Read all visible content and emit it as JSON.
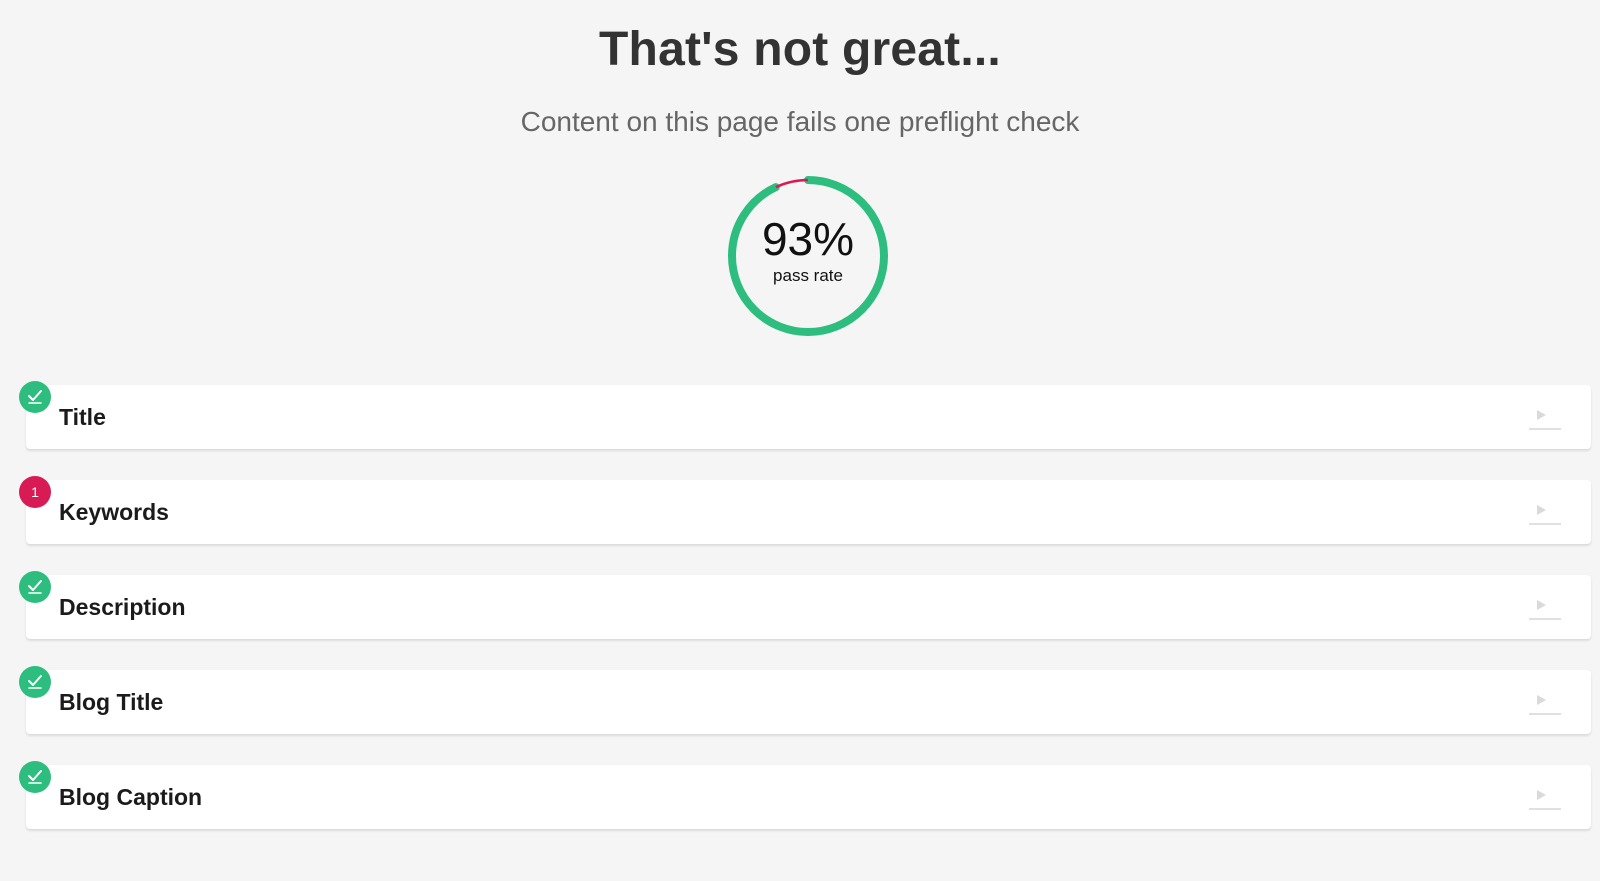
{
  "heading": "That's not great...",
  "subheading": "Content on this page fails one preflight check",
  "gauge": {
    "percent": 93,
    "value_text": "93%",
    "label": "pass rate",
    "pass_color": "#2dbd7e",
    "fail_color": "#d81b55"
  },
  "checks": [
    {
      "label": "Title",
      "status": "pass",
      "badge_icon": "check-icon",
      "count": ""
    },
    {
      "label": "Keywords",
      "status": "fail",
      "badge_icon": "",
      "count": "1"
    },
    {
      "label": "Description",
      "status": "pass",
      "badge_icon": "check-icon",
      "count": ""
    },
    {
      "label": "Blog Title",
      "status": "pass",
      "badge_icon": "check-icon",
      "count": ""
    },
    {
      "label": "Blog Caption",
      "status": "pass",
      "badge_icon": "check-icon",
      "count": ""
    }
  ],
  "row_action_icon": "play-arrow-icon",
  "colors": {
    "pass": "#2dbd7e",
    "fail": "#d81b55",
    "background": "#f6f5f6"
  }
}
